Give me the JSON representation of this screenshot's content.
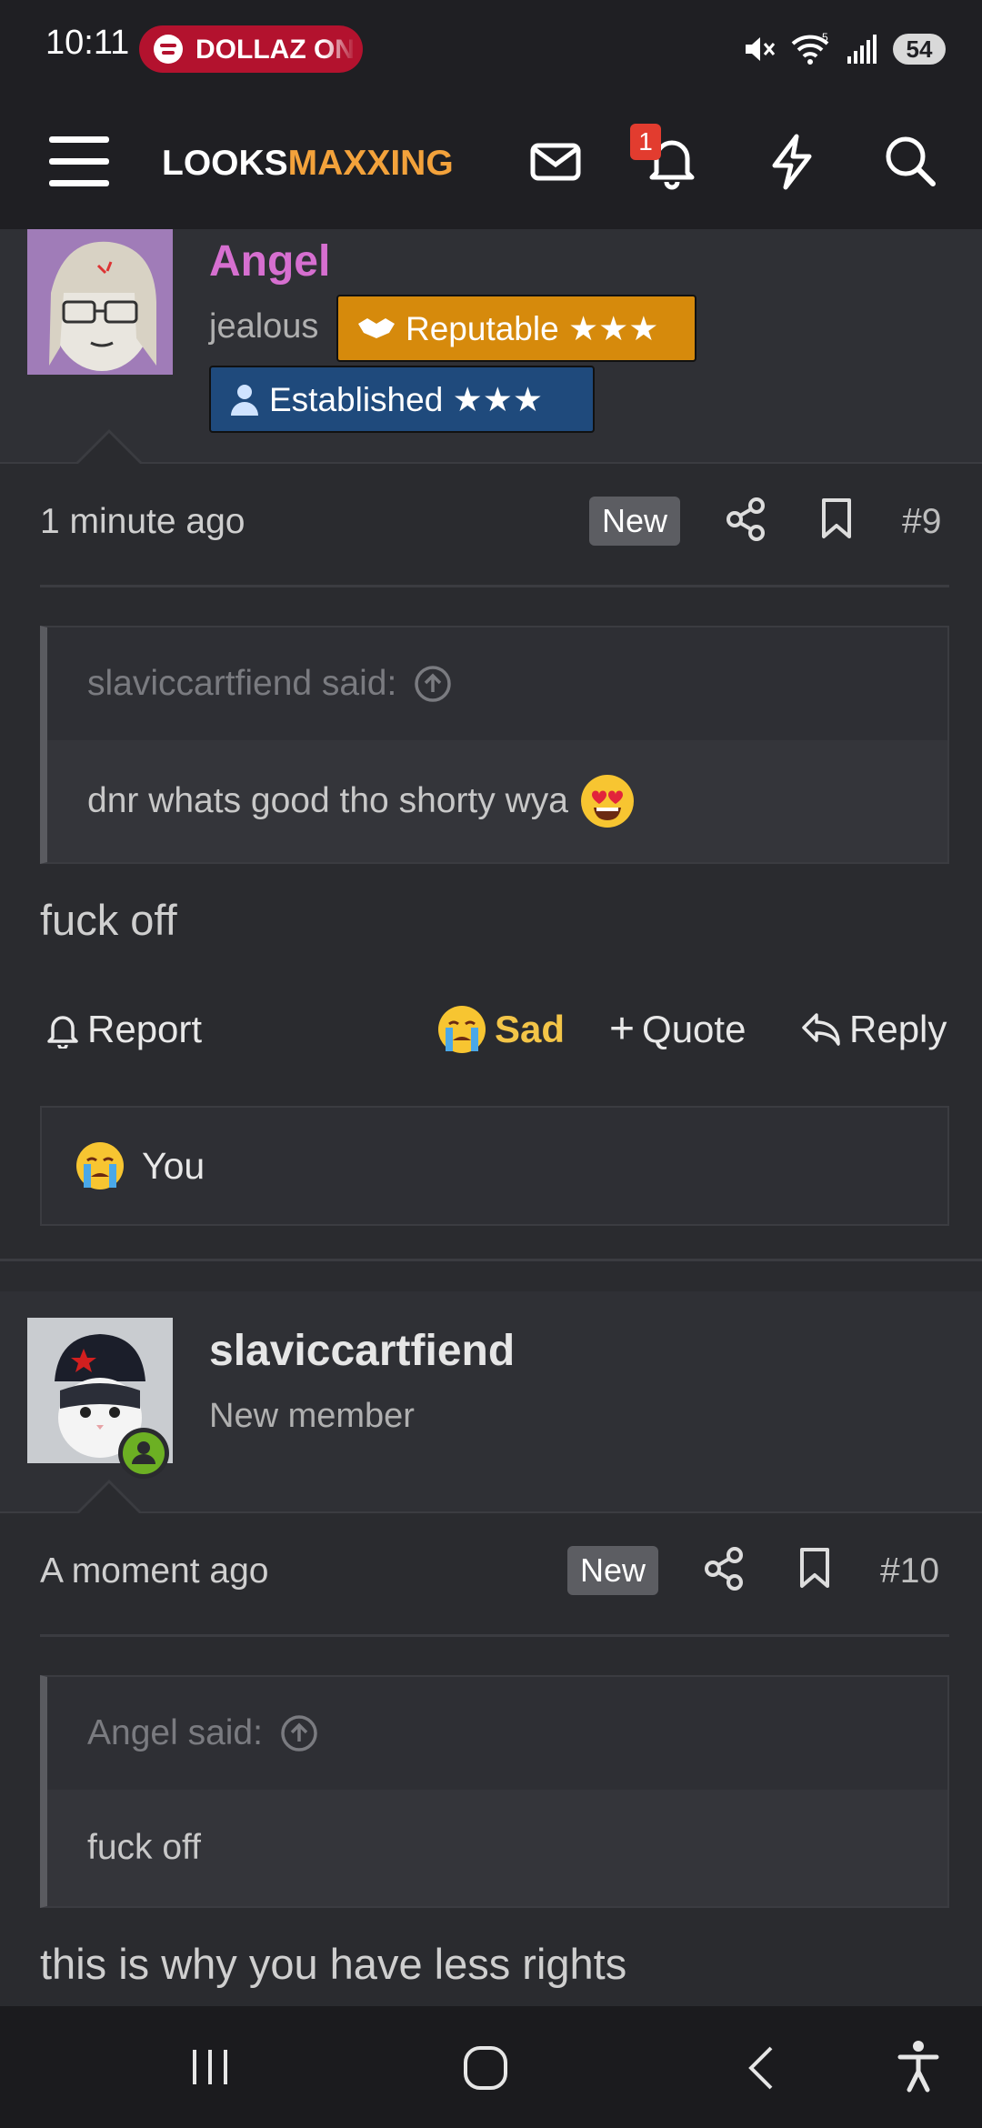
{
  "status_bar": {
    "time": "10:11",
    "media_label": "DOLLAZ ON",
    "battery": "54"
  },
  "navbar": {
    "logo_part1": "LOOKS",
    "logo_part2": "MAXXING",
    "notification_count": "1"
  },
  "posts": [
    {
      "username": "Angel",
      "user_title": "jealous",
      "banners": [
        "Reputable ★★★",
        "Established ★★★"
      ],
      "time": "1 minute ago",
      "new_label": "New",
      "post_number": "#9",
      "quote_author": "slaviccartfiend said:",
      "quote_text": "dnr whats good tho shorty wya",
      "body": "fuck off",
      "actions": {
        "report": "Report",
        "reaction": "Sad",
        "quote": "Quote",
        "reply": "Reply"
      },
      "reactions_summary": "You"
    },
    {
      "username": "slaviccartfiend",
      "user_title": "New member",
      "time": "A moment ago",
      "new_label": "New",
      "post_number": "#10",
      "quote_author": "Angel said:",
      "quote_text": "fuck off",
      "body": "this is why you have less rights"
    }
  ],
  "colors": {
    "angel_name": "#d66fd0",
    "reputable_banner": "#d68a0c",
    "established_banner": "#1f4a7c",
    "sad_reaction": "#f3c548",
    "brand_accent": "#f3a23b"
  }
}
